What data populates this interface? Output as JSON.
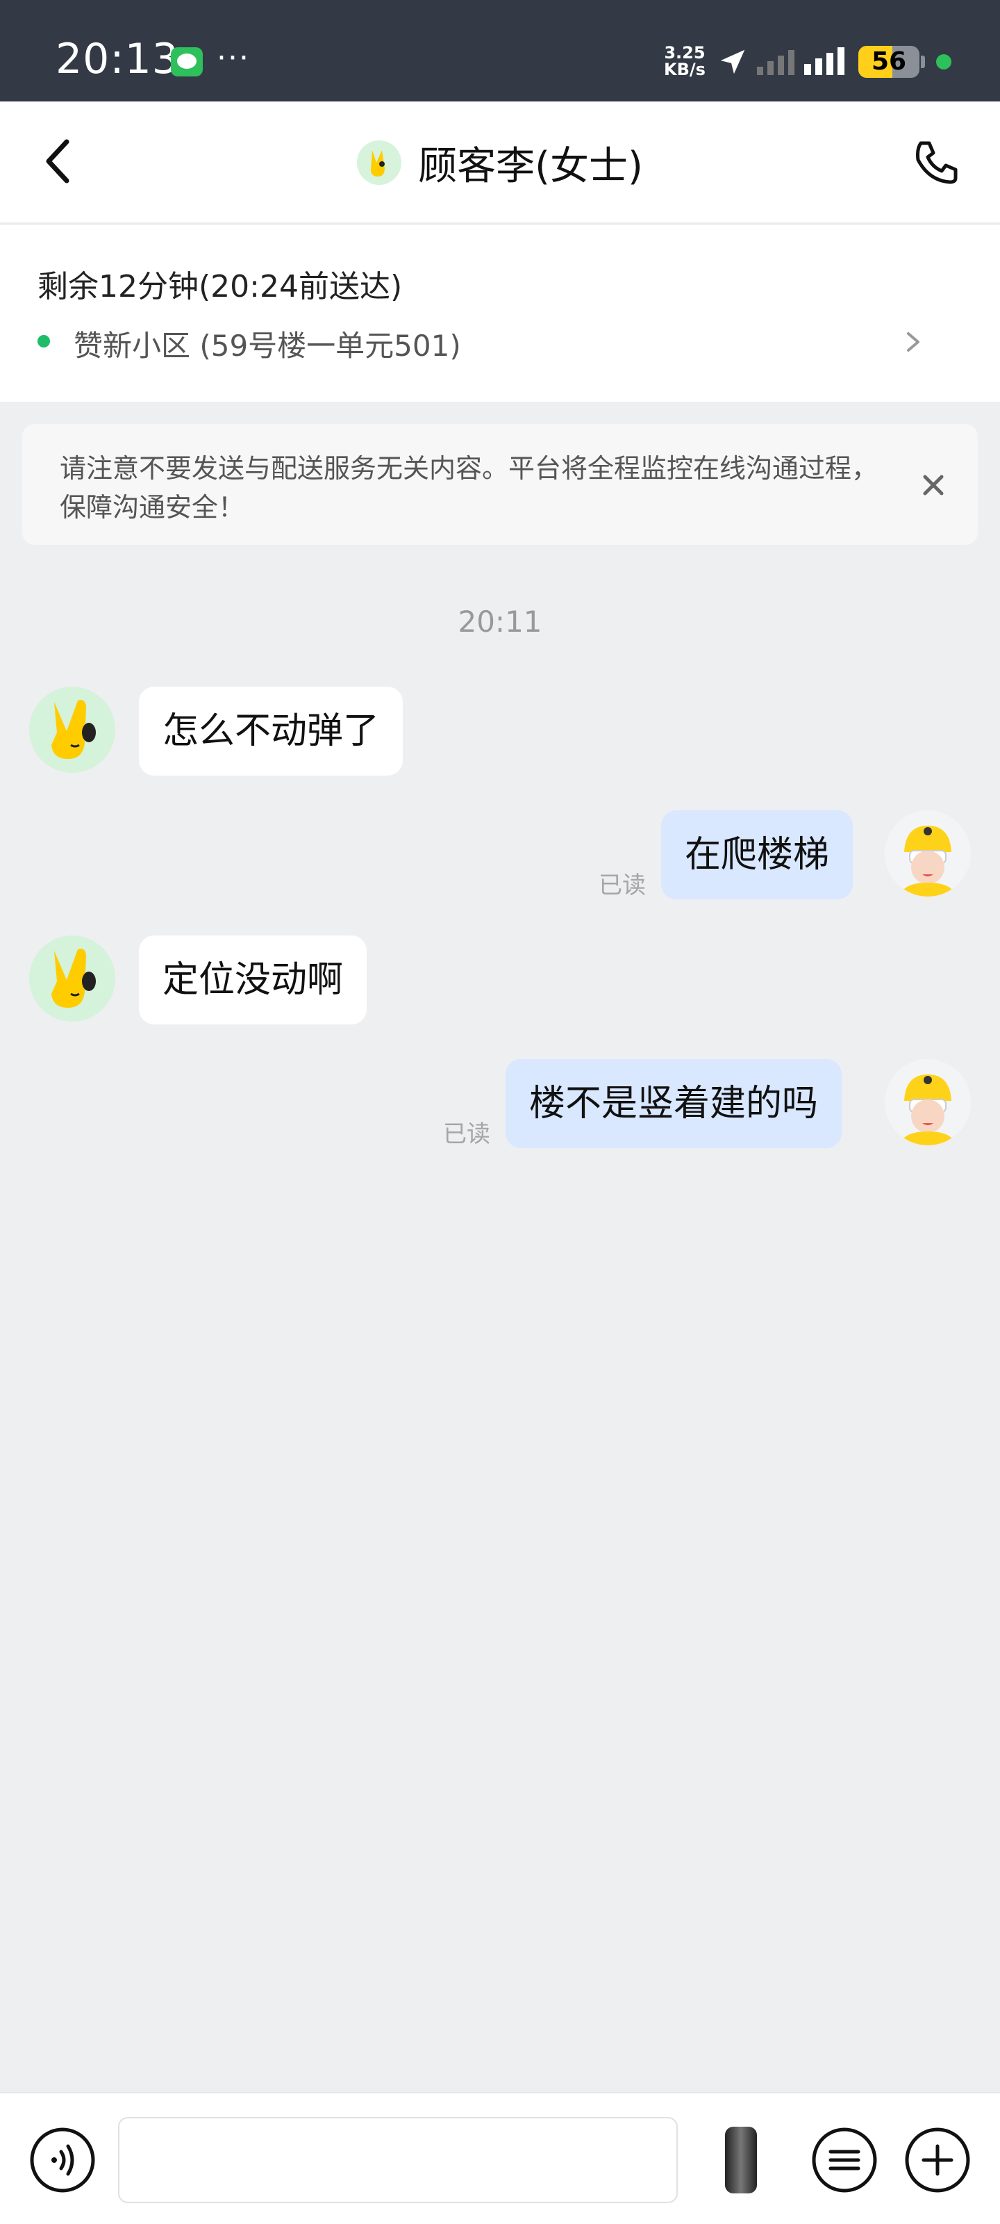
{
  "status_bar": {
    "time": "20:13",
    "more": "···",
    "net_speed_value": "3.25",
    "net_speed_unit": "KB/s",
    "battery": "56",
    "battery_level": 0.56,
    "icons": [
      "message-app-icon",
      "location-arrow-icon",
      "signal-icon",
      "signal-icon",
      "battery-icon"
    ]
  },
  "header": {
    "back_icon": "chevron-left-icon",
    "contact_name": "顾客李(女士)",
    "phone_icon": "phone-icon"
  },
  "order": {
    "eta": "剩余12分钟(20:24前送达)",
    "address": "赞新小区 (59号楼一单元501)",
    "status_color": "#1fbd6a"
  },
  "notice": {
    "text": "请注意不要发送与配送服务无关内容。平台将全程监控在线沟通过程，保障沟通安全！"
  },
  "chat": {
    "time_divider": "20:11",
    "messages": [
      {
        "from": "customer",
        "text": "怎么不动弹了"
      },
      {
        "from": "rider",
        "text": "在爬楼梯",
        "status": "已读"
      },
      {
        "from": "customer",
        "text": "定位没动啊"
      },
      {
        "from": "rider",
        "text": "楼不是竖着建的吗",
        "status": "已读"
      }
    ]
  },
  "input_bar": {
    "input_value": "",
    "placeholder": "",
    "icons": [
      "voice-icon",
      "emoji-icon",
      "plus-icon"
    ]
  },
  "colors": {
    "status_bar_bg": "#333a46",
    "accent_yellow": "#ffcf1a",
    "outgoing_bubble": "#d9e7ff",
    "incoming_bubble": "#ffffff",
    "chat_bg": "#eeeff1"
  }
}
